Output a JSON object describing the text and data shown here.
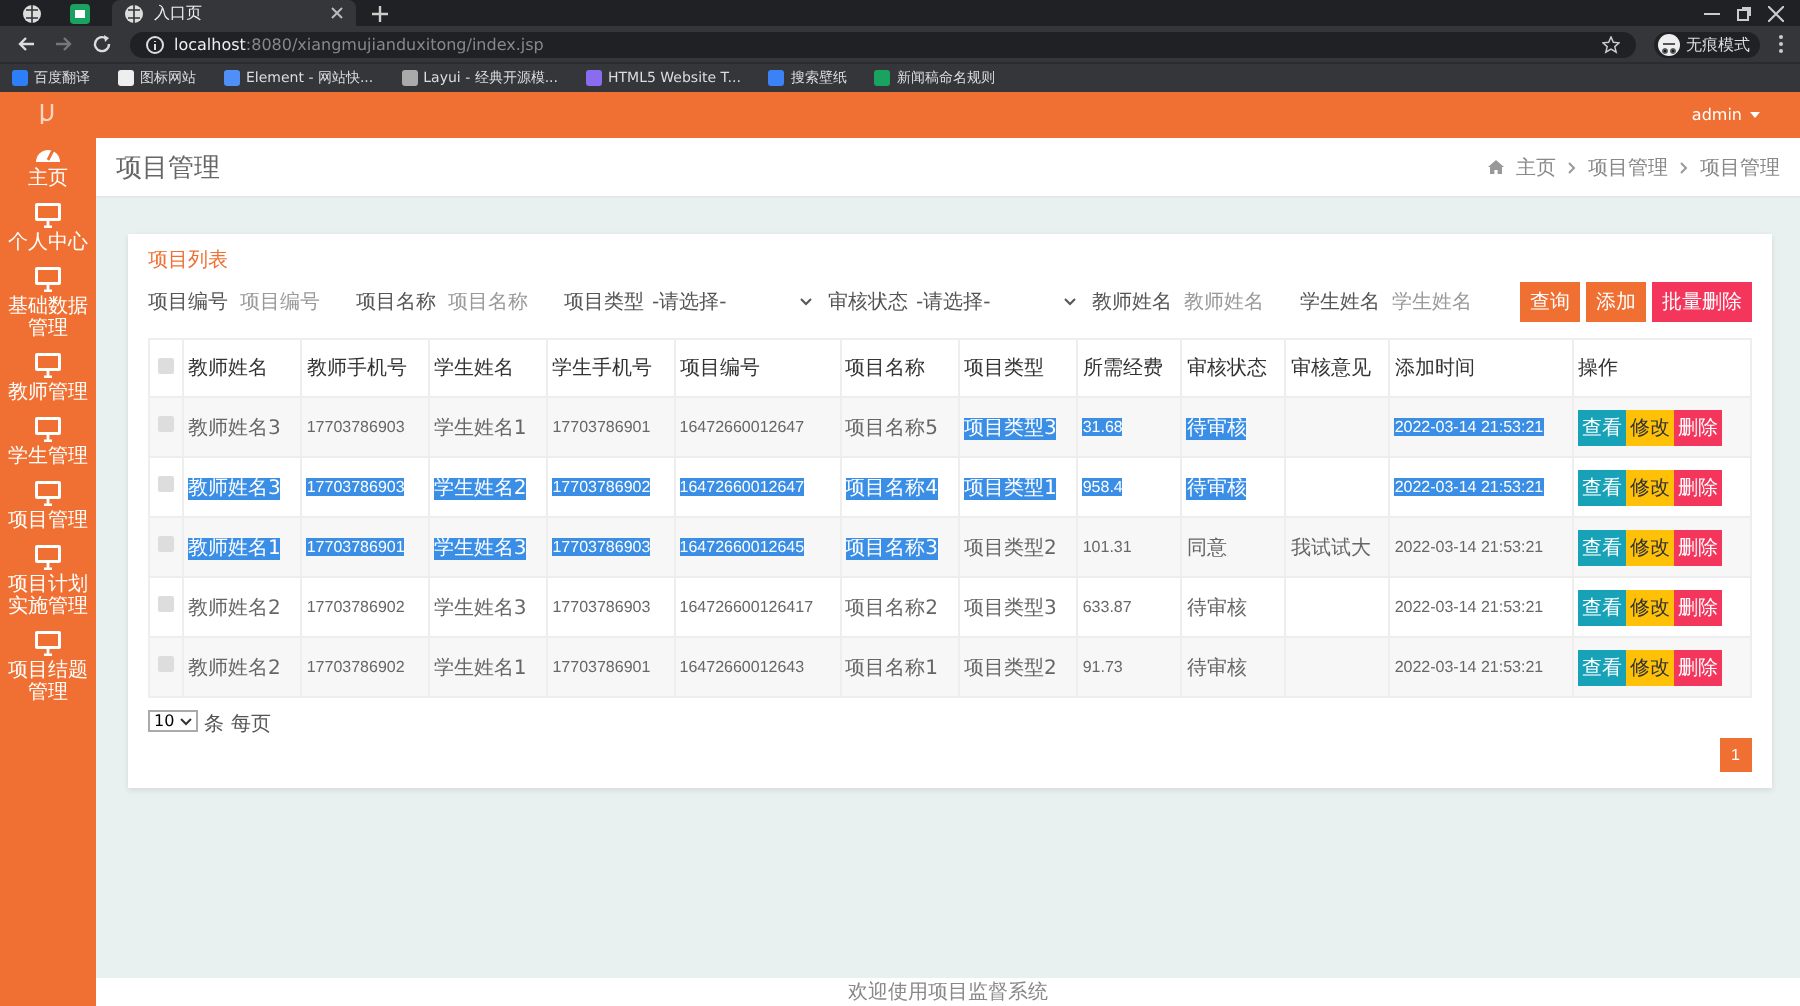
{
  "browser": {
    "tabs": [
      {
        "kind": "pinned-globe",
        "selected": false
      },
      {
        "kind": "pinned-app",
        "selected": false
      },
      {
        "kind": "page",
        "title": "入口页",
        "selected": true
      }
    ],
    "url_host": "localhost",
    "url_rest": ":8080/xiangmujianduxitong/index.jsp",
    "profile": "无痕模式",
    "bookmarks": [
      "百度翻译",
      "图标网站",
      "Element - 网站快...",
      "Layui - 经典开源模...",
      "HTML5 Website T...",
      "搜索壁纸",
      "新闻稿命名规则"
    ]
  },
  "header": {
    "user": "admin"
  },
  "sidebar": {
    "items": [
      {
        "kind": "dashboard",
        "label": "主页"
      },
      {
        "kind": "monitor",
        "label": "个人中心"
      },
      {
        "kind": "monitor",
        "label": "基础数据管理"
      },
      {
        "kind": "monitor",
        "label": "教师管理"
      },
      {
        "kind": "monitor",
        "label": "学生管理"
      },
      {
        "kind": "monitor",
        "label": "项目管理"
      },
      {
        "kind": "monitor",
        "label": "项目计划实施管理"
      },
      {
        "kind": "monitor",
        "label": "项目结题管理"
      }
    ]
  },
  "page": {
    "title": "项目管理",
    "breadcrumb": [
      "主页",
      "项目管理",
      "项目管理"
    ]
  },
  "panel": {
    "title": "项目列表",
    "filters": [
      {
        "kind": "input",
        "label": "项目编号",
        "placeholder": "项目编号"
      },
      {
        "kind": "input",
        "label": "项目名称",
        "placeholder": "项目名称"
      },
      {
        "kind": "select",
        "label": "项目类型",
        "value": "-请选择-"
      },
      {
        "kind": "select",
        "label": "审核状态",
        "value": "-请选择-"
      },
      {
        "kind": "input",
        "label": "教师姓名",
        "placeholder": "教师姓名"
      },
      {
        "kind": "input",
        "label": "学生姓名",
        "placeholder": "学生姓名"
      }
    ],
    "buttons": [
      {
        "label": "查询",
        "kind": "primary"
      },
      {
        "label": "添加",
        "kind": "primary"
      },
      {
        "label": "批量删除",
        "kind": "danger"
      }
    ]
  },
  "table": {
    "all_checked": false,
    "columns": [
      "教师姓名",
      "教师手机号",
      "学生姓名",
      "学生手机号",
      "项目编号",
      "项目名称",
      "项目类型",
      "所需经费",
      "审核状态",
      "审核意见",
      "添加时间",
      "操作"
    ],
    "rows": [
      {
        "checked": false,
        "cells": [
          {
            "text": "教师姓名3",
            "highlighted": false
          },
          {
            "text": "17703786903",
            "highlighted": false
          },
          {
            "text": "学生姓名1",
            "highlighted": false
          },
          {
            "text": "17703786901",
            "highlighted": false
          },
          {
            "text": "16472660012647",
            "highlighted": false
          },
          {
            "text": "项目名称5",
            "highlighted": false
          },
          {
            "text": "项目类型3",
            "highlighted": true
          },
          {
            "text": "31.68",
            "highlighted": true
          },
          {
            "text": "待审核",
            "highlighted": true
          },
          null,
          {
            "text": "2022-03-14 21:53:21",
            "highlighted": true
          }
        ],
        "actions": [
          {
            "label": "查看",
            "kind": "view"
          },
          {
            "label": "修改",
            "kind": "edit"
          },
          {
            "label": "删除",
            "kind": "delete"
          }
        ]
      },
      {
        "checked": false,
        "cells": [
          {
            "text": "教师姓名3",
            "highlighted": true
          },
          {
            "text": "17703786903",
            "highlighted": true
          },
          {
            "text": "学生姓名2",
            "highlighted": true
          },
          {
            "text": "17703786902",
            "highlighted": true
          },
          {
            "text": "16472660012647",
            "highlighted": true
          },
          {
            "text": "项目名称4",
            "highlighted": true
          },
          {
            "text": "项目类型1",
            "highlighted": true
          },
          {
            "text": "958.4",
            "highlighted": true
          },
          {
            "text": "待审核",
            "highlighted": true
          },
          null,
          {
            "text": "2022-03-14 21:53:21",
            "highlighted": true
          }
        ],
        "actions": [
          {
            "label": "查看",
            "kind": "view"
          },
          {
            "label": "修改",
            "kind": "edit"
          },
          {
            "label": "删除",
            "kind": "delete"
          }
        ]
      },
      {
        "checked": false,
        "cells": [
          {
            "text": "教师姓名1",
            "highlighted": true
          },
          {
            "text": "17703786901",
            "highlighted": true
          },
          {
            "text": "学生姓名3",
            "highlighted": true
          },
          {
            "text": "17703786903",
            "highlighted": true
          },
          {
            "text": "16472660012645",
            "highlighted": true
          },
          {
            "text": "项目名称3",
            "highlighted": true
          },
          {
            "text": "项目类型2",
            "highlighted": false
          },
          {
            "text": "101.31",
            "highlighted": false
          },
          {
            "text": "同意",
            "highlighted": false
          },
          {
            "text": "我试试大",
            "highlighted": false
          },
          {
            "text": "2022-03-14 21:53:21",
            "highlighted": false
          }
        ],
        "actions": [
          {
            "label": "查看",
            "kind": "view"
          },
          {
            "label": "修改",
            "kind": "edit"
          },
          {
            "label": "删除",
            "kind": "delete"
          }
        ]
      },
      {
        "checked": false,
        "cells": [
          {
            "text": "教师姓名2",
            "highlighted": false
          },
          {
            "text": "17703786902",
            "highlighted": false
          },
          {
            "text": "学生姓名3",
            "highlighted": false
          },
          {
            "text": "17703786903",
            "highlighted": false
          },
          {
            "text": "164726600126417",
            "highlighted": false
          },
          {
            "text": "项目名称2",
            "highlighted": false
          },
          {
            "text": "项目类型3",
            "highlighted": false
          },
          {
            "text": "633.87",
            "highlighted": false
          },
          {
            "text": "待审核",
            "highlighted": false
          },
          null,
          {
            "text": "2022-03-14 21:53:21",
            "highlighted": false
          }
        ],
        "actions": [
          {
            "label": "查看",
            "kind": "view"
          },
          {
            "label": "修改",
            "kind": "edit"
          },
          {
            "label": "删除",
            "kind": "delete"
          }
        ]
      },
      {
        "checked": false,
        "cells": [
          {
            "text": "教师姓名2",
            "highlighted": false
          },
          {
            "text": "17703786902",
            "highlighted": false
          },
          {
            "text": "学生姓名1",
            "highlighted": false
          },
          {
            "text": "17703786901",
            "highlighted": false
          },
          {
            "text": "16472660012643",
            "highlighted": false
          },
          {
            "text": "项目名称1",
            "highlighted": false
          },
          {
            "text": "项目类型2",
            "highlighted": false
          },
          {
            "text": "91.73",
            "highlighted": false
          },
          {
            "text": "待审核",
            "highlighted": false
          },
          null,
          {
            "text": "2022-03-14 21:53:21",
            "highlighted": false
          }
        ],
        "actions": [
          {
            "label": "查看",
            "kind": "view"
          },
          {
            "label": "修改",
            "kind": "edit"
          },
          {
            "label": "删除",
            "kind": "delete"
          }
        ]
      }
    ]
  },
  "pagination": {
    "page_size": "10",
    "page_size_label": "条 每页",
    "pages": [
      {
        "label": "1",
        "selected": true
      }
    ]
  },
  "footer": "欢迎使用项目监督系统"
}
